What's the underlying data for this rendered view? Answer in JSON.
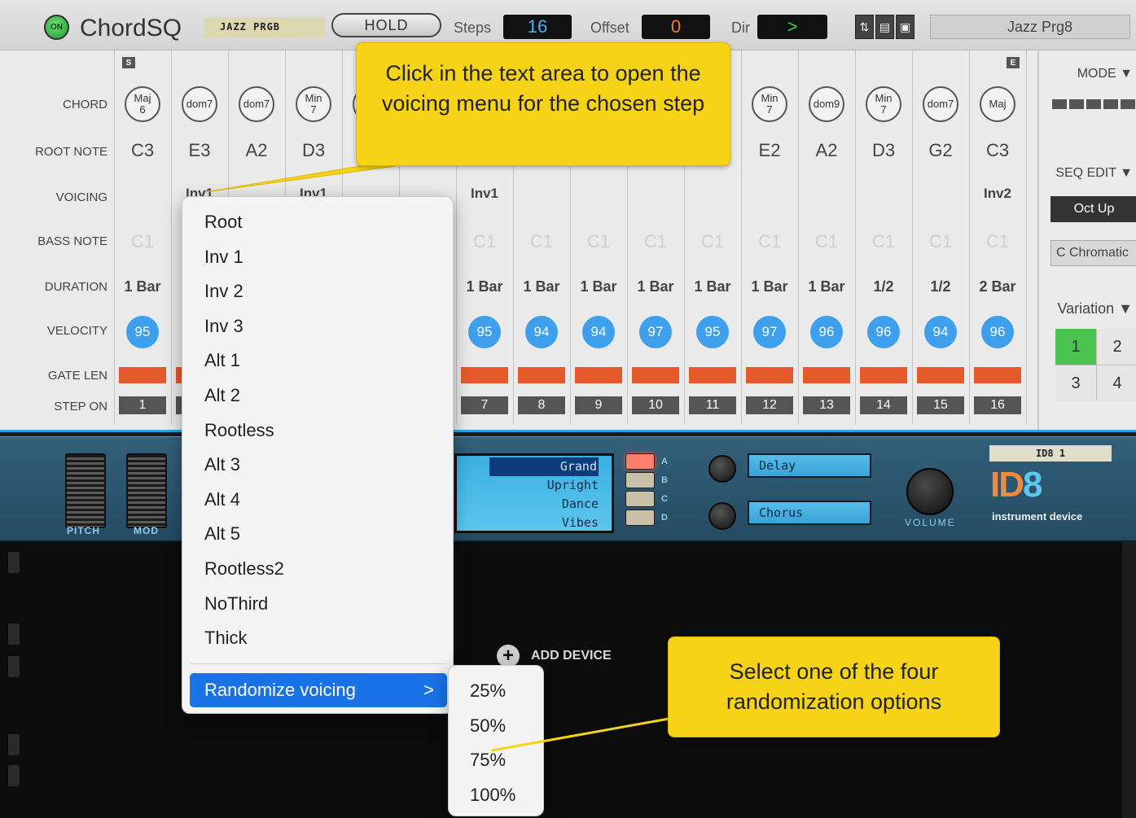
{
  "chordsq": {
    "on_label": "ON",
    "title": "ChordSQ",
    "patch_tape": "JAZZ PRGB",
    "hold_label": "HOLD",
    "steps_label": "Steps",
    "steps_value": "16",
    "offset_label": "Offset",
    "offset_value": "0",
    "dir_label": "Dir",
    "dir_value": ">",
    "patch_name": "Jazz Prg8",
    "start_marker": "S",
    "end_marker": "E",
    "row_labels": {
      "chord": "CHORD",
      "root": "ROOT NOTE",
      "voicing": "VOICING",
      "bass": "BASS NOTE",
      "duration": "DURATION",
      "velocity": "VELOCITY",
      "gate": "GATE LEN",
      "step_on": "STEP ON"
    },
    "steps": [
      {
        "chord": [
          "Maj",
          "6"
        ],
        "root": "C3",
        "voicing": "",
        "bass": "C1",
        "duration": "1 Bar",
        "velocity": "95",
        "num": "1"
      },
      {
        "chord": [
          "dom7"
        ],
        "root": "E3",
        "voicing": "Inv1",
        "bass": "",
        "duration": "",
        "velocity": "",
        "num": ""
      },
      {
        "chord": [
          "dom7"
        ],
        "root": "A2",
        "voicing": "",
        "bass": "",
        "duration": "",
        "velocity": "",
        "num": ""
      },
      {
        "chord": [
          "Min",
          "7"
        ],
        "root": "D3",
        "voicing": "Inv1",
        "bass": "",
        "duration": "",
        "velocity": "",
        "num": ""
      },
      {
        "chord": [
          ""
        ],
        "root": "",
        "voicing": "",
        "bass": "",
        "duration": "",
        "velocity": "",
        "num": ""
      },
      {
        "chord": [
          ""
        ],
        "root": "",
        "voicing": "",
        "bass": "",
        "duration": "",
        "velocity": "",
        "num": ""
      },
      {
        "chord": [
          ""
        ],
        "root": "",
        "voicing": "Inv1",
        "bass": "C1",
        "duration": "1 Bar",
        "velocity": "95",
        "num": "7"
      },
      {
        "chord": [
          ""
        ],
        "root": "",
        "voicing": "",
        "bass": "C1",
        "duration": "1 Bar",
        "velocity": "94",
        "num": "8"
      },
      {
        "chord": [
          ""
        ],
        "root": "",
        "voicing": "",
        "bass": "C1",
        "duration": "1 Bar",
        "velocity": "94",
        "num": "9"
      },
      {
        "chord": [
          ""
        ],
        "root": "",
        "voicing": "",
        "bass": "C1",
        "duration": "1 Bar",
        "velocity": "97",
        "num": "10"
      },
      {
        "chord": [
          ""
        ],
        "root": "",
        "voicing": "",
        "bass": "C1",
        "duration": "1 Bar",
        "velocity": "95",
        "num": "11"
      },
      {
        "chord": [
          "Min",
          "7"
        ],
        "root": "E2",
        "voicing": "",
        "bass": "C1",
        "duration": "1 Bar",
        "velocity": "97",
        "num": "12"
      },
      {
        "chord": [
          "dom9"
        ],
        "root": "A2",
        "voicing": "",
        "bass": "C1",
        "duration": "1 Bar",
        "velocity": "96",
        "num": "13"
      },
      {
        "chord": [
          "Min",
          "7"
        ],
        "root": "D3",
        "voicing": "",
        "bass": "C1",
        "duration": "1/2",
        "velocity": "96",
        "num": "14"
      },
      {
        "chord": [
          "dom7"
        ],
        "root": "G2",
        "voicing": "",
        "bass": "C1",
        "duration": "1/2",
        "velocity": "94",
        "num": "15"
      },
      {
        "chord": [
          "Maj"
        ],
        "root": "C3",
        "voicing": "Inv2",
        "bass": "C1",
        "duration": "2 Bar",
        "velocity": "96",
        "num": "16"
      }
    ],
    "right_panel": {
      "mode_label": "MODE ▼",
      "seq_edit_label": "SEQ EDIT ▼",
      "seq_edit_value": "Oct Up",
      "scale_value": "C Chromatic",
      "variation_label": "Variation ▼",
      "variations": [
        "1",
        "2",
        "3",
        "4"
      ],
      "active_variation": "1"
    }
  },
  "id8": {
    "pitch_label": "PITCH",
    "mod_label": "MOD",
    "presets": [
      "Grand",
      "Upright",
      "Dance",
      "Vibes"
    ],
    "selected_preset": "Grand",
    "preset_letters": [
      "A",
      "B",
      "C",
      "D"
    ],
    "fx1": "Delay",
    "fx2": "Chorus",
    "volume_label": "VOLUME",
    "tape_label": "ID8 1",
    "logo_id": "ID",
    "logo_8": "8",
    "subtitle": "instrument device"
  },
  "rack": {
    "add_device_label": "ADD DEVICE"
  },
  "voicing_menu": {
    "items": [
      "Root",
      "Inv 1",
      "Inv 2",
      "Inv 3",
      "Alt 1",
      "Alt 2",
      "Rootless",
      "Alt 3",
      "Alt 4",
      "Alt 5",
      "Rootless2",
      "NoThird",
      "Thick"
    ],
    "randomize_label": "Randomize voicing",
    "chevron": ">"
  },
  "randomize_submenu": {
    "items": [
      "25%",
      "50%",
      "75%",
      "100%"
    ]
  },
  "callouts": {
    "top": "Click in the text area to open the voicing menu for the chosen step",
    "bottom": "Select one of the four randomization options"
  },
  "colors": {
    "velocity_blue": "#3ea0ec",
    "gate_orange": "#e55a2b",
    "callout_yellow": "#f7d317",
    "menu_highlight": "#1a73e6",
    "variation_active": "#4cc252"
  }
}
